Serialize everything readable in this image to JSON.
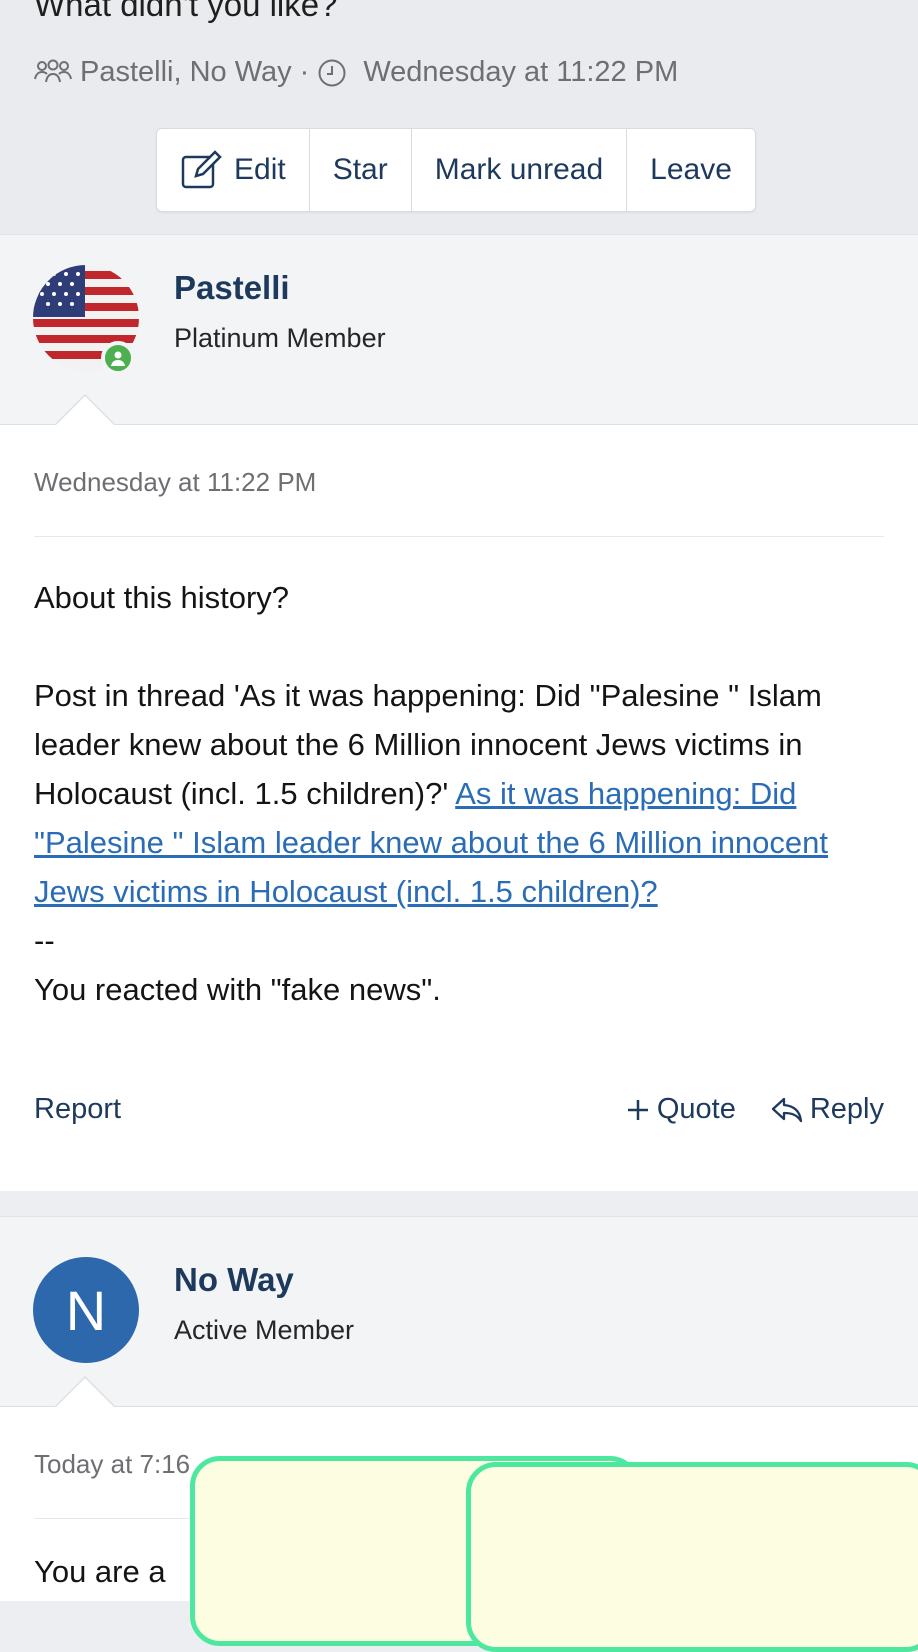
{
  "thread": {
    "title": "What didn't you like?",
    "participants": "Pastelli, No Way",
    "separator": "·",
    "date": "Wednesday at 11:22 PM"
  },
  "toolbar": {
    "edit_label": "Edit",
    "star_label": "Star",
    "mark_unread_label": "Mark unread",
    "leave_label": "Leave"
  },
  "messages": [
    {
      "username": "Pastelli",
      "user_title": "Platinum Member",
      "avatar_icon": "us-flag-icon",
      "online": true,
      "date": "Wednesday at 11:22 PM",
      "line1": "About this history?",
      "text_prefix": "Post in thread 'As it was happening: Did \"Palesine \" Islam leader knew about the 6 Million innocent Jews victims in Holocaust (incl. 1.5 children)?' ",
      "link_text": "As it was happening: Did \"Palesine \" Islam leader knew about the 6 Million innocent Jews victims in Holocaust (incl. 1.5 children)?",
      "dashes": "--",
      "reaction_note": "You reacted with \"fake news\".",
      "report_label": "Report",
      "quote_label": "Quote",
      "reply_label": "Reply"
    },
    {
      "username": "No Way",
      "user_title": "Active Member",
      "avatar_letter": "N",
      "avatar_color": "#2d68ad",
      "date": "Today at 7:16",
      "text_partial": "You are a"
    }
  ],
  "colors": {
    "link": "#2a6cb5",
    "username": "#1d3a5c",
    "online": "#4caf50",
    "overlay_fill": "#fdfde1",
    "overlay_border": "#4ee7a0"
  }
}
